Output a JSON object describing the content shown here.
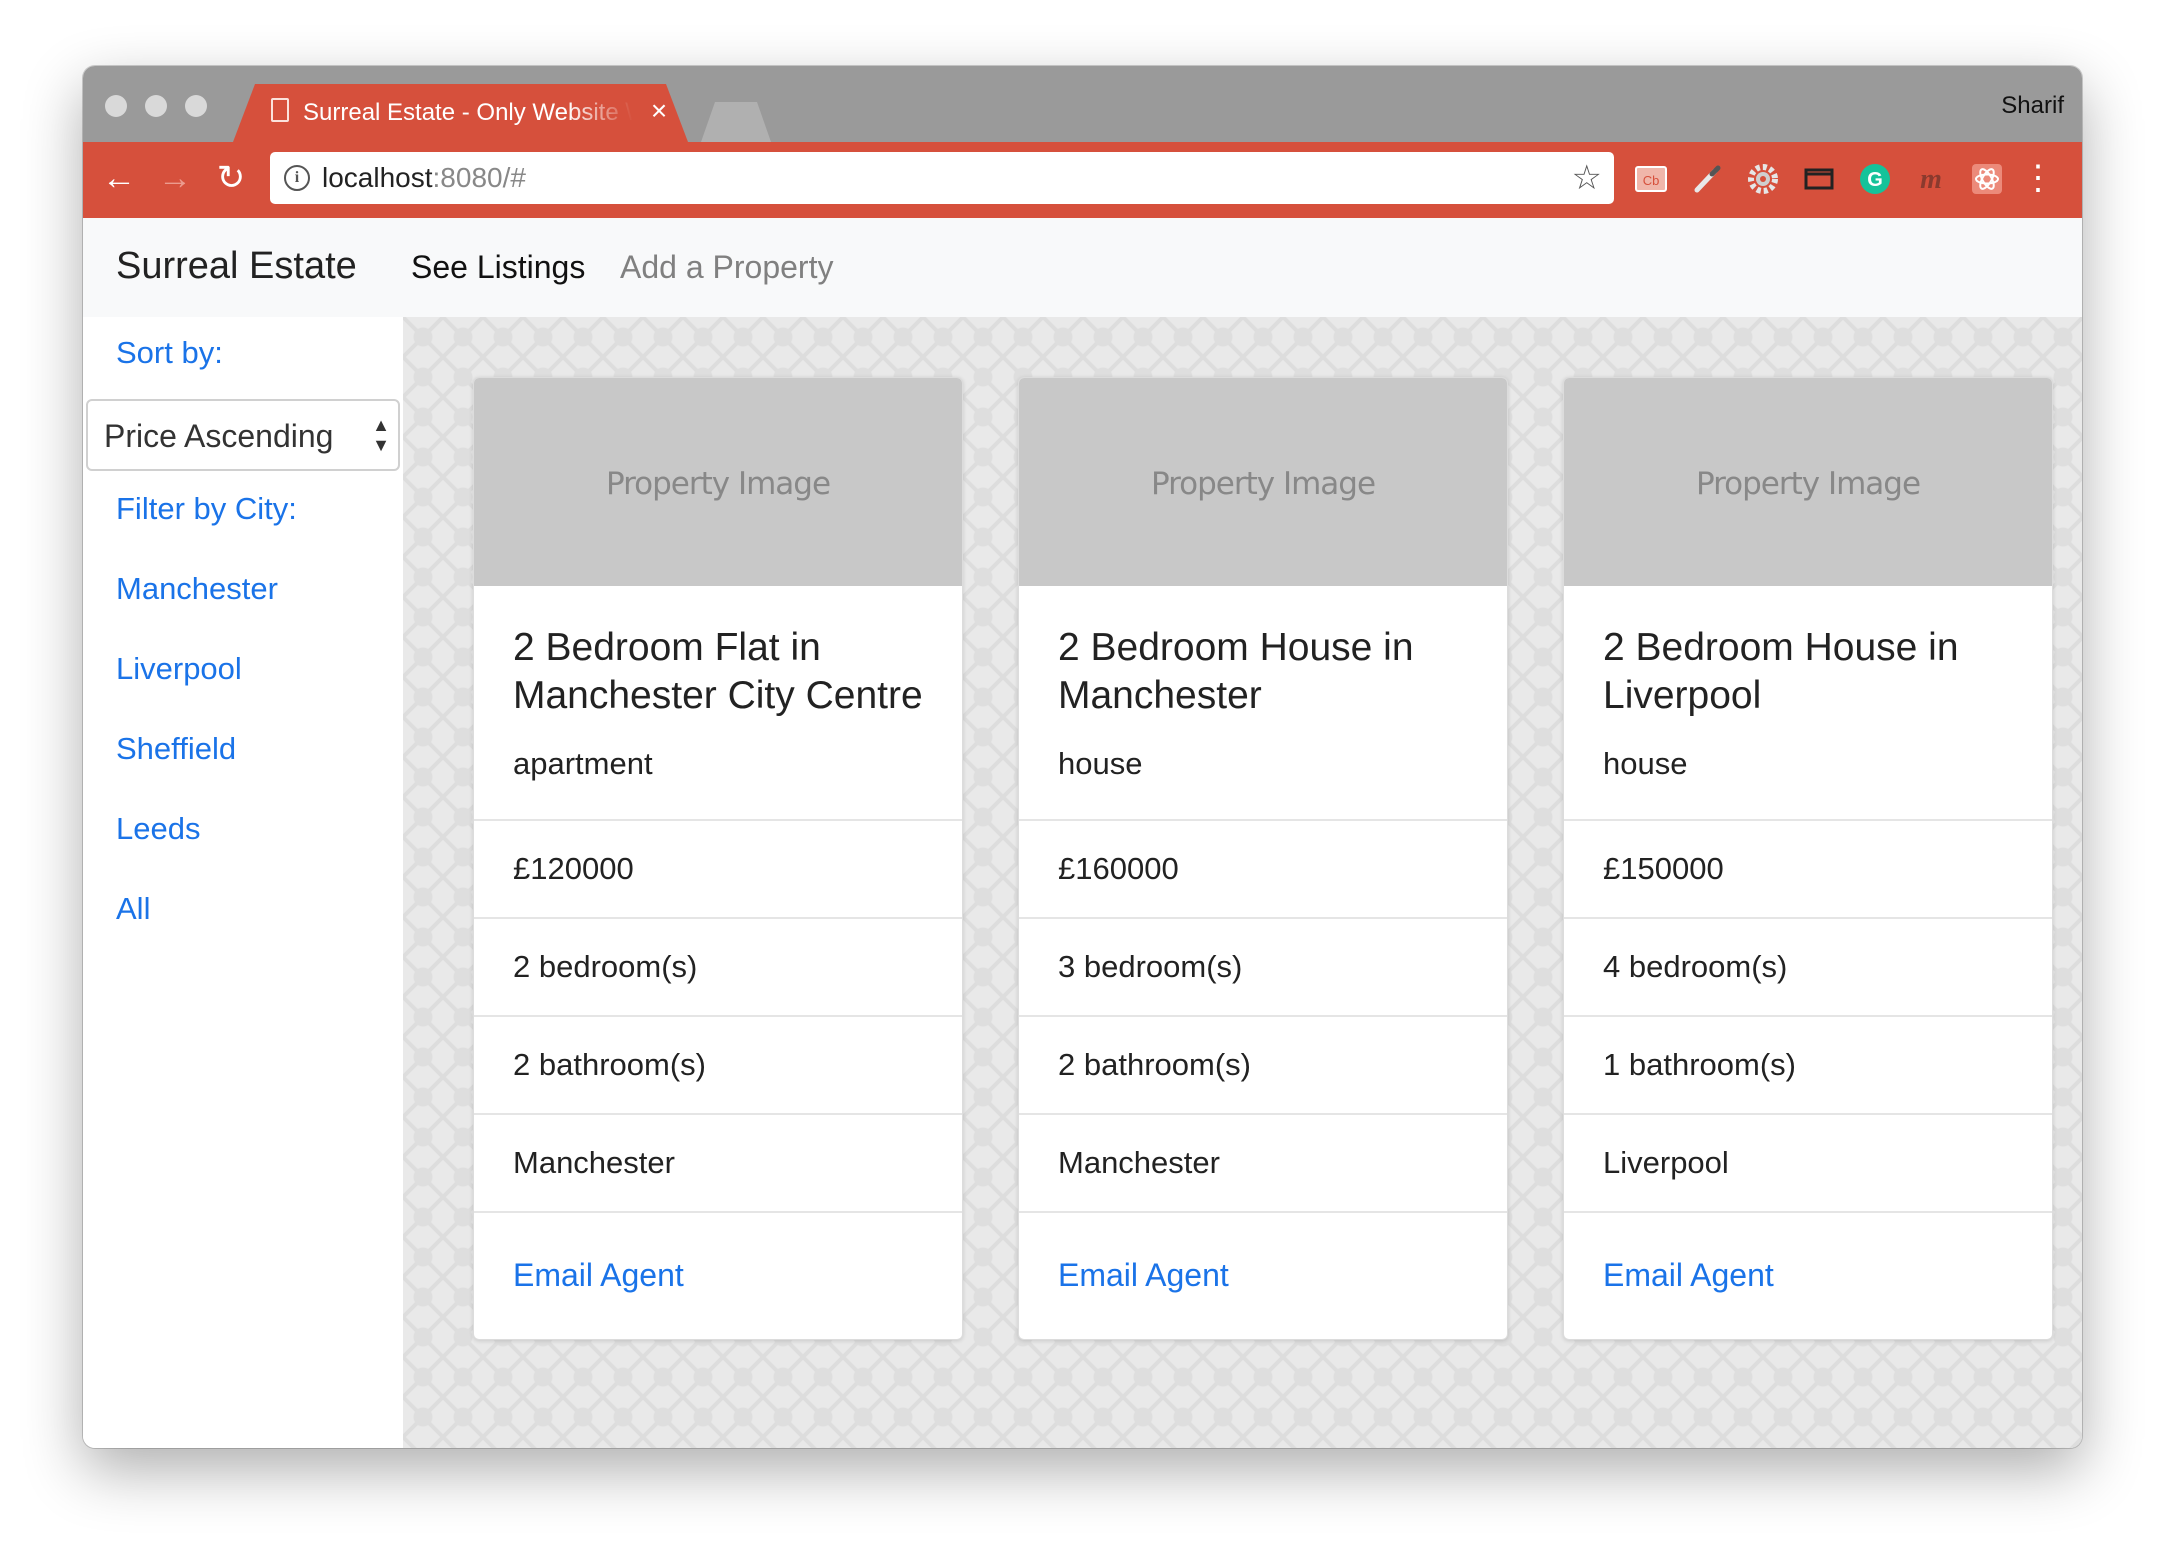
{
  "browser": {
    "tab_title": "Surreal Estate - Only Website \\",
    "tab_close": "×",
    "profile_name": "Sharif",
    "url_host": "localhost",
    "url_rest": ":8080/#",
    "nav_icons": {
      "back": "←",
      "forward": "→",
      "reload": "↻",
      "star": "☆",
      "menu": "⋮"
    },
    "extensions": [
      "cb-extension-icon",
      "eyedropper-icon",
      "gear-icon",
      "window-icon",
      "grammarly-icon",
      "m-extension-icon",
      "react-devtools-icon"
    ],
    "colors": {
      "toolbar": "#d6503c",
      "tabstrip": "#9a9a9a"
    }
  },
  "app": {
    "brand": "Surreal Estate",
    "nav": {
      "listings": "See Listings",
      "add": "Add a Property"
    },
    "accent": "#1a73e8"
  },
  "sidebar": {
    "sort_label": "Sort by:",
    "sort_selected": "Price Ascending",
    "filter_label": "Filter by City:",
    "cities": [
      "Manchester",
      "Liverpool",
      "Sheffield",
      "Leeds",
      "All"
    ]
  },
  "listings": [
    {
      "image": "Property Image",
      "title": "2 Bedroom Flat in Manchester City Centre",
      "type": "apartment",
      "price": "£120000",
      "bedrooms": "2 bedroom(s)",
      "bathrooms": "2 bathroom(s)",
      "city": "Manchester",
      "email": "Email Agent"
    },
    {
      "image": "Property Image",
      "title": "2 Bedroom House in Manchester",
      "type": "house",
      "price": "£160000",
      "bedrooms": "3 bedroom(s)",
      "bathrooms": "2 bathroom(s)",
      "city": "Manchester",
      "email": "Email Agent"
    },
    {
      "image": "Property Image",
      "title": "2 Bedroom House in Liverpool",
      "type": "house",
      "price": "£150000",
      "bedrooms": "4 bedroom(s)",
      "bathrooms": "1 bathroom(s)",
      "city": "Liverpool",
      "email": "Email Agent"
    }
  ]
}
